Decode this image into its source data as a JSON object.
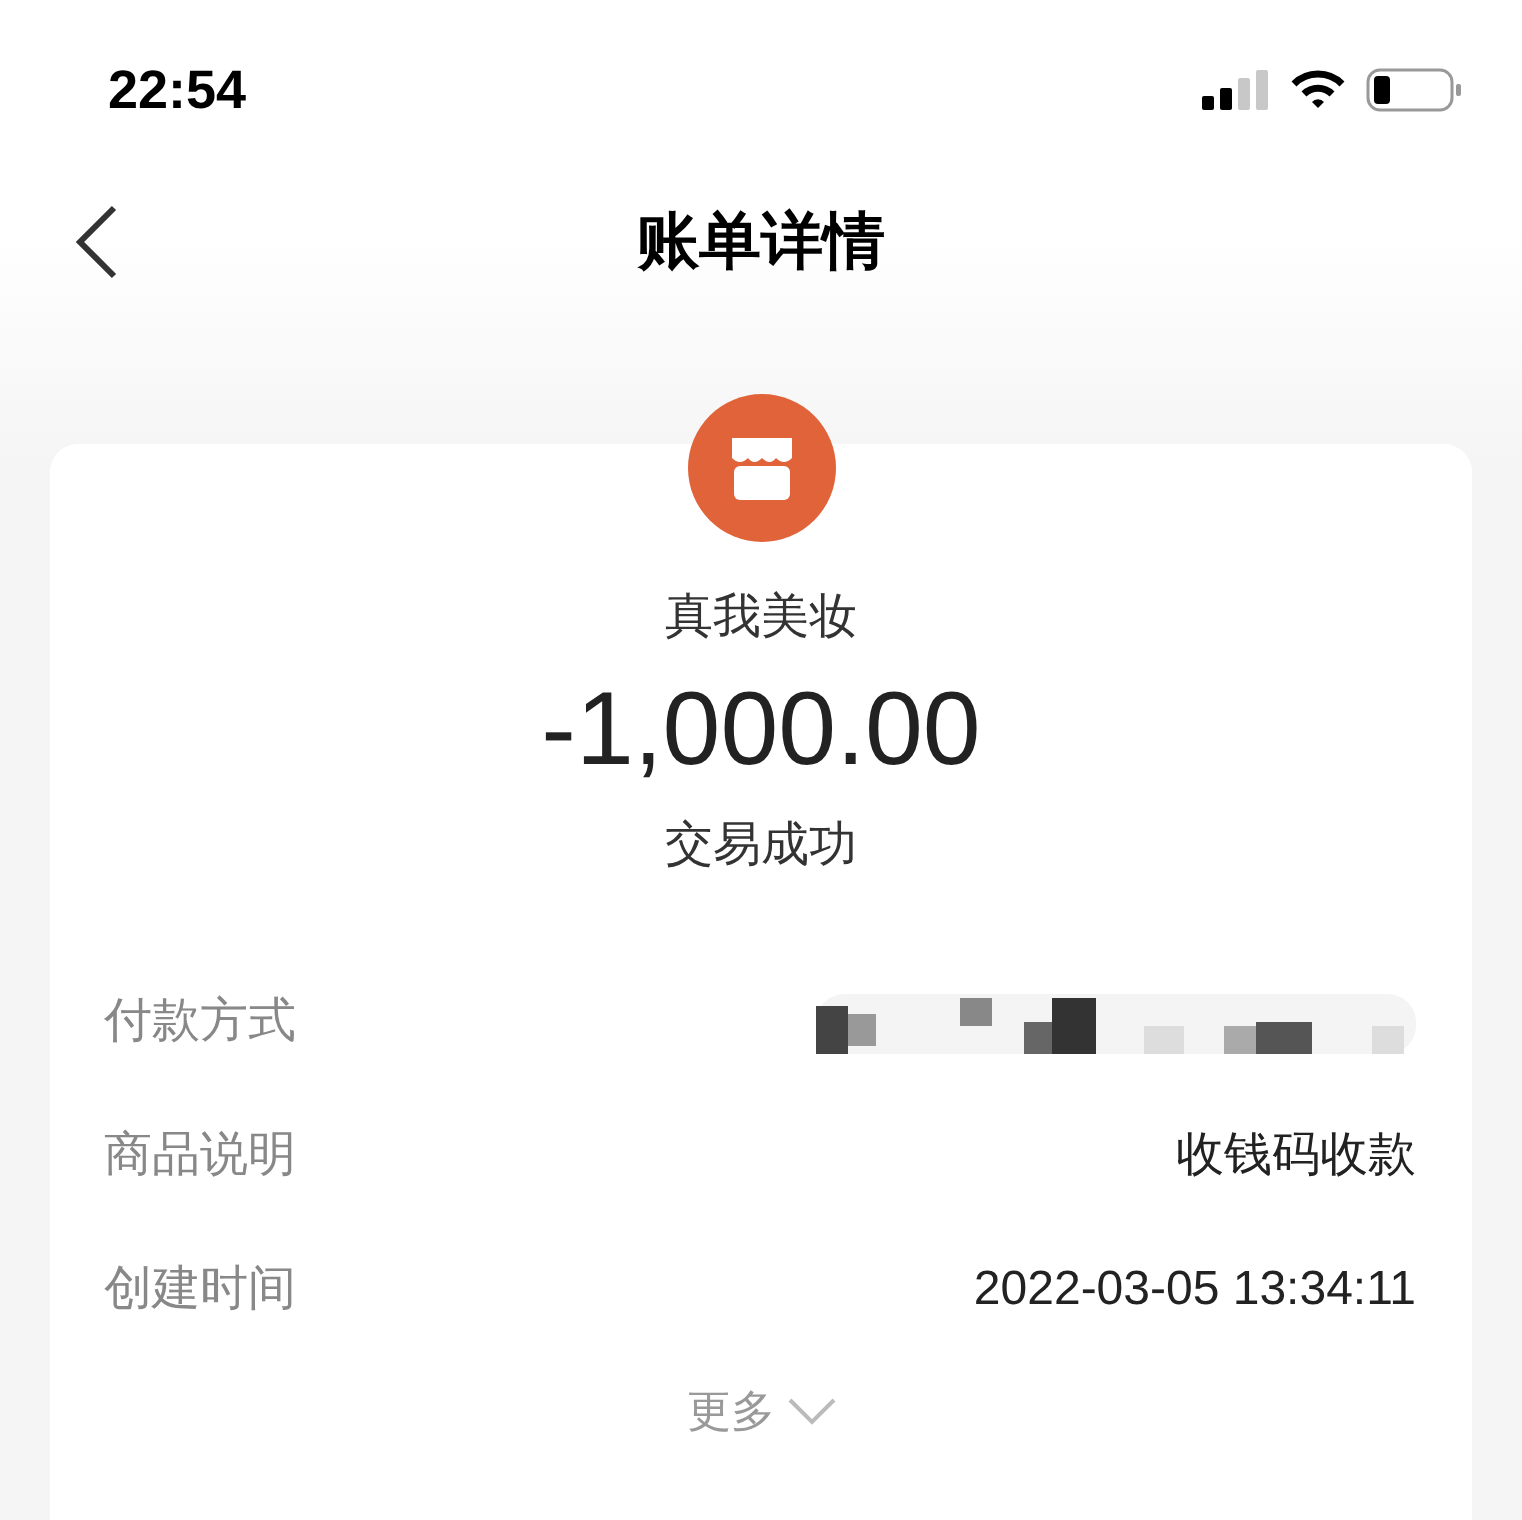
{
  "status_bar": {
    "time": "22:54"
  },
  "nav": {
    "title": "账单详情"
  },
  "bill": {
    "merchant": "真我美妆",
    "amount": "-1,000.00",
    "status": "交易成功"
  },
  "rows": [
    {
      "label": "付款方式",
      "kind": "redacted"
    },
    {
      "label": "商品说明",
      "kind": "text",
      "value": "收钱码收款"
    },
    {
      "label": "创建时间",
      "kind": "text",
      "value": "2022-03-05 13:34:11"
    }
  ],
  "more": {
    "label": "更多"
  }
}
